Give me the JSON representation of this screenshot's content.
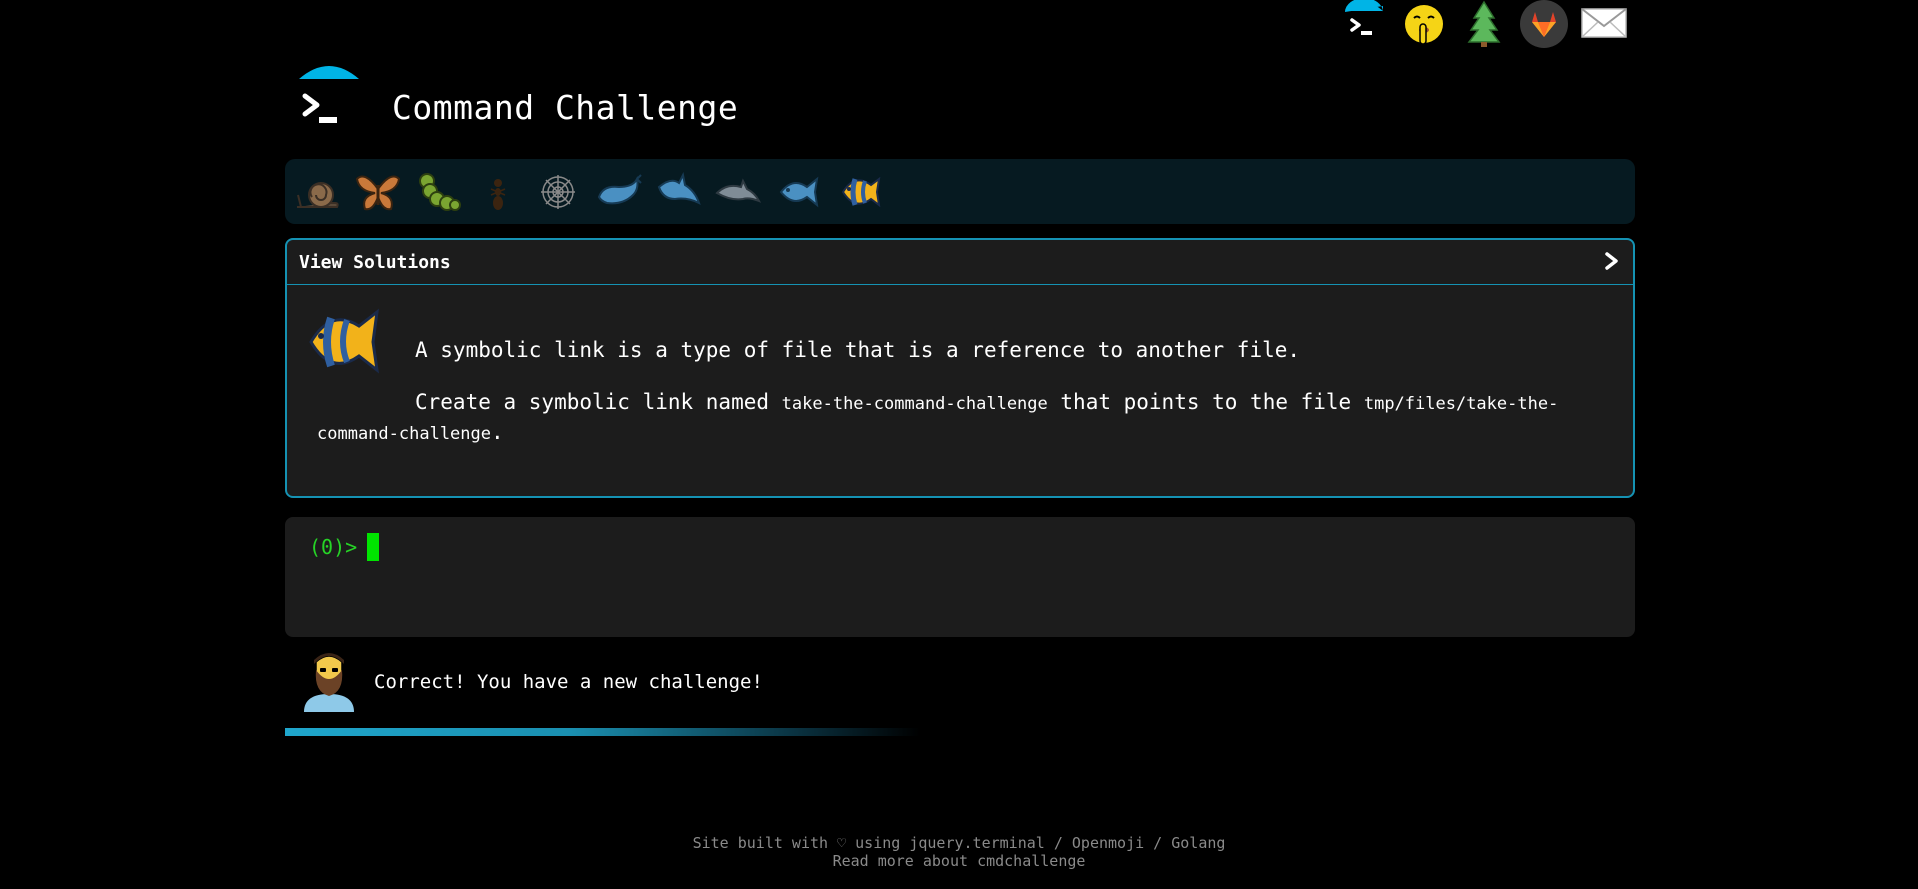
{
  "header": {
    "title": "Command Challenge",
    "logo_icon": "terminal-icon"
  },
  "top_nav": {
    "icons": [
      "terminal-icon",
      "shushing-face-icon",
      "tree-icon",
      "gitlab-icon",
      "envelope-icon"
    ]
  },
  "levels": {
    "icons": [
      "snail-icon",
      "butterfly-icon",
      "caterpillar-icon",
      "ant-icon",
      "spiderweb-icon",
      "whale-icon",
      "shark-icon",
      "dolphin-icon",
      "fish-icon",
      "tropical-fish-icon"
    ],
    "current": "tropical-fish-icon"
  },
  "challenge": {
    "view_solutions": "View Solutions",
    "chevron": "❯",
    "intro": "A symbolic link is a type of file that is a reference to another file.",
    "task_prefix": "Create a symbolic link named ",
    "link_name": "take-the-command-challenge",
    "task_middle": " that points to the file ",
    "target_file": "tmp/files/take-the-command-challenge",
    "task_suffix": "."
  },
  "terminal": {
    "prompt": "(0)>"
  },
  "feedback": {
    "message": "Correct! You have a new challenge!",
    "progress_fraction": 0.47
  },
  "footer": {
    "line1_prefix": "Site built with",
    "heart": "♡",
    "line1_using": "using",
    "link_jquery": "jquery.terminal",
    "sep1": "/",
    "link_openmoji": "Openmoji",
    "sep2": "/",
    "link_golang": "Golang",
    "line2_prefix": "Read more about",
    "link_about": "cmdchallenge"
  },
  "colors": {
    "accent": "#1592b3",
    "prompt_green": "#26d426",
    "cursor_green": "#00e400",
    "panel_bg": "#1c1c1c",
    "level_bar_bg": "#061a21"
  }
}
